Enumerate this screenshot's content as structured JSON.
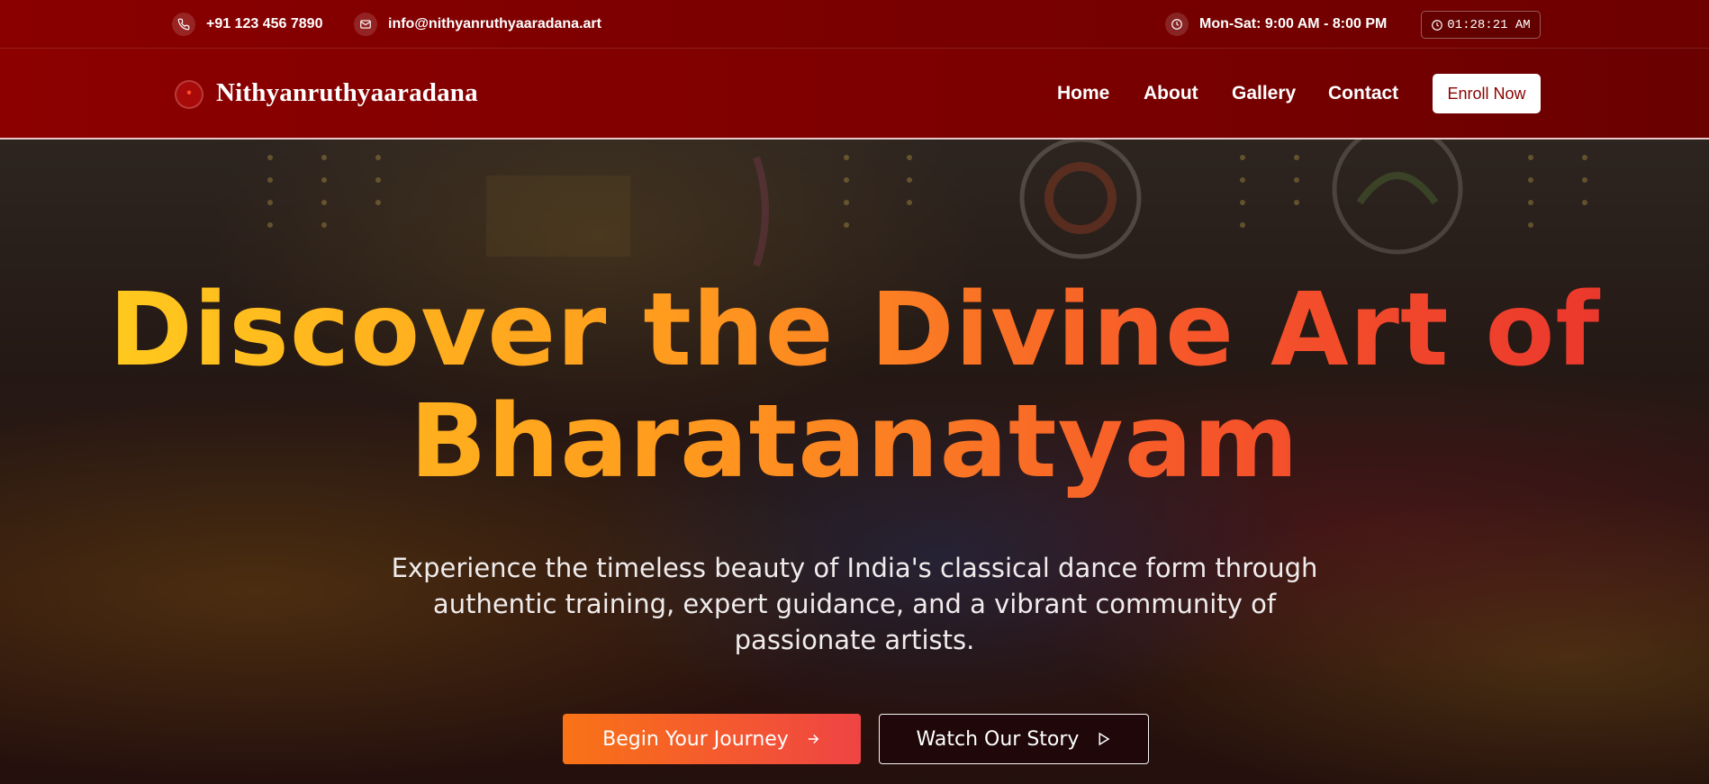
{
  "topbar": {
    "phone": "+91 123 456 7890",
    "phone_icon": "phone-icon",
    "email": "info@nithyanruthyaaradana.art",
    "email_icon": "mail-icon",
    "hours": "Mon-Sat: 9:00 AM - 8:00 PM",
    "hours_icon": "clock-icon",
    "clock": "01:28:21 AM"
  },
  "nav": {
    "brand": "Nithyanruthyaaradana",
    "logo_icon": "dance-logo-icon",
    "links": [
      "Home",
      "About",
      "Gallery",
      "Contact"
    ],
    "cta": "Enroll Now"
  },
  "hero": {
    "title_line1": "Discover the Divine Art of",
    "title_line2": "Bharatanatyam",
    "subtitle": "Experience the timeless beauty of India's classical dance form through authentic training, expert guidance, and a vibrant community of passionate artists.",
    "primary_button": "Begin Your Journey",
    "primary_icon": "arrow-right-icon",
    "secondary_button": "Watch Our Story",
    "secondary_icon": "play-icon"
  },
  "colors": {
    "header_bg": "#8a0000",
    "accent_orange": "#f97316",
    "accent_red": "#ef4444",
    "title_gradient_start": "#ffd21e",
    "title_gradient_end": "#e8302e"
  }
}
